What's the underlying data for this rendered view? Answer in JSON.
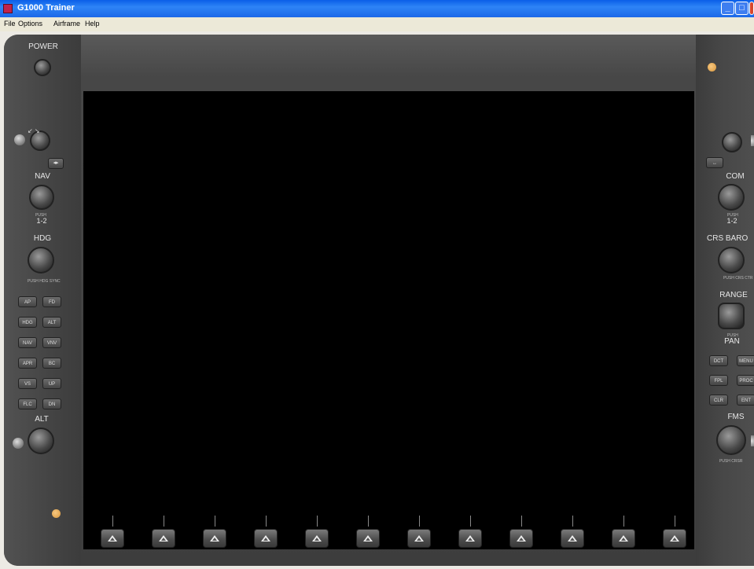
{
  "window": {
    "title": "G1000 Trainer"
  },
  "menu": [
    "File",
    "Options",
    "Airframe",
    "Help"
  ],
  "left_panel": {
    "power": "POWER",
    "nav": "NAV",
    "nav_push": "PUSH",
    "nav_push_value": "1-2",
    "hdg": "HDG",
    "hdg_push": "PUSH HDG SYNC",
    "alt": "ALT",
    "keys": [
      "AP",
      "FD",
      "HDG",
      "ALT",
      "NAV",
      "VNV",
      "APR",
      "BC",
      "VS",
      "UP",
      "FLC",
      "DN"
    ]
  },
  "right_panel": {
    "com": "COM",
    "com_push": "PUSH",
    "com_push_value": "1-2",
    "crs_baro": "CRS BARO",
    "crs_push": "PUSH CRS CTR",
    "range": "RANGE",
    "pan_push": "PUSH",
    "pan": "PAN",
    "fms": "FMS",
    "fms_push": "PUSH CRSR",
    "keys": [
      "DCT",
      "MENU",
      "FPL",
      "PROC",
      "CLR",
      "ENT"
    ]
  },
  "softkeys_count": 12,
  "colors": {
    "bezel": "#444444",
    "screen": "#000000",
    "lamp": "#e8a850"
  }
}
